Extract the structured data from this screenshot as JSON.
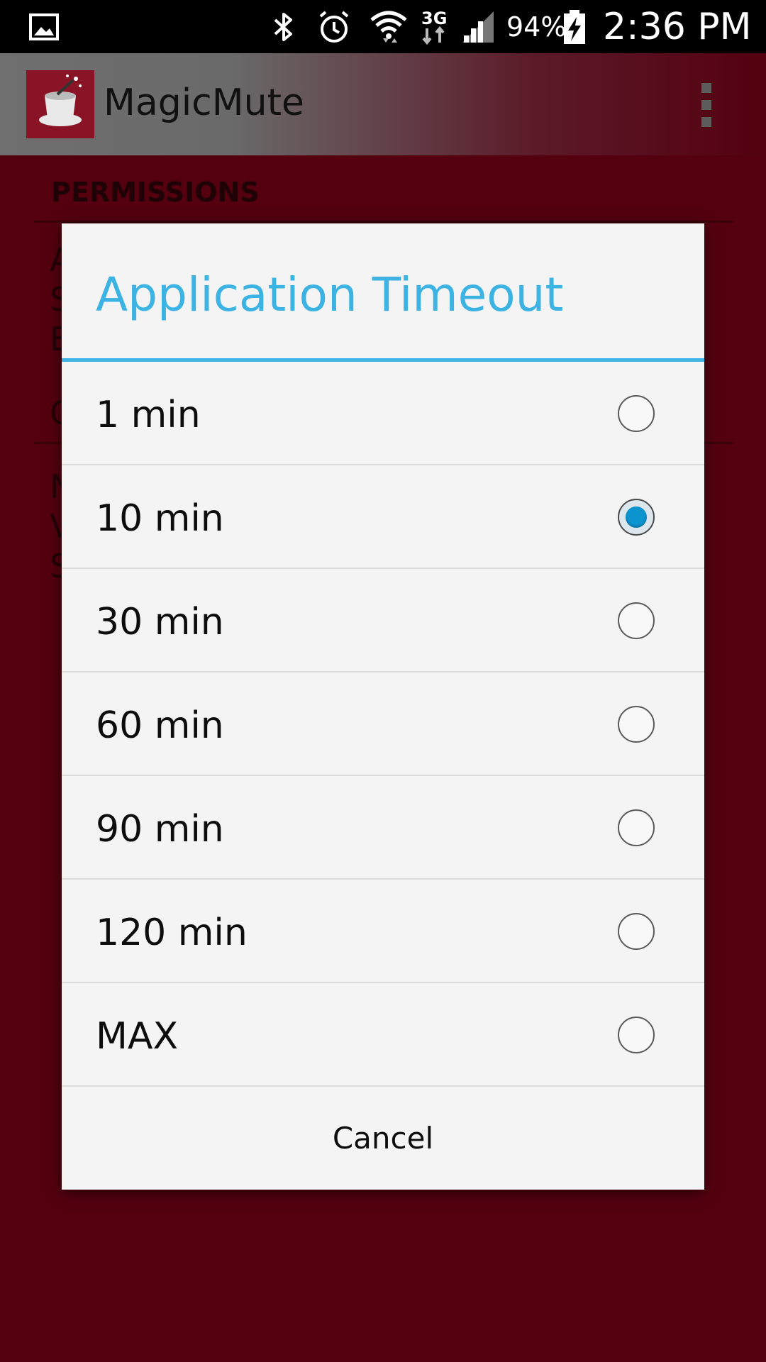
{
  "status_bar": {
    "battery_percent": "94%",
    "time": "2:36 PM",
    "network": "3G",
    "icons": [
      "gallery-icon",
      "bluetooth-icon",
      "alarm-icon",
      "wifi-icon",
      "network-3g-icon",
      "signal-icon",
      "battery-charging-icon"
    ]
  },
  "app_bar": {
    "title": "MagicMute",
    "logo_icon": "magic-hat-icon",
    "menu_icon": "overflow-menu-icon"
  },
  "background": {
    "section_header": "PERMISSIONS"
  },
  "dialog": {
    "title": "Application Timeout",
    "options": [
      {
        "label": "1 min",
        "selected": false
      },
      {
        "label": "10 min",
        "selected": true
      },
      {
        "label": "30 min",
        "selected": false
      },
      {
        "label": "60 min",
        "selected": false
      },
      {
        "label": "90 min",
        "selected": false
      },
      {
        "label": "120 min",
        "selected": false
      },
      {
        "label": "MAX",
        "selected": false
      }
    ],
    "cancel_label": "Cancel"
  },
  "colors": {
    "accent": "#3cb3e2",
    "radio_selected": "#0c94cf",
    "app_background": "#54000f"
  }
}
